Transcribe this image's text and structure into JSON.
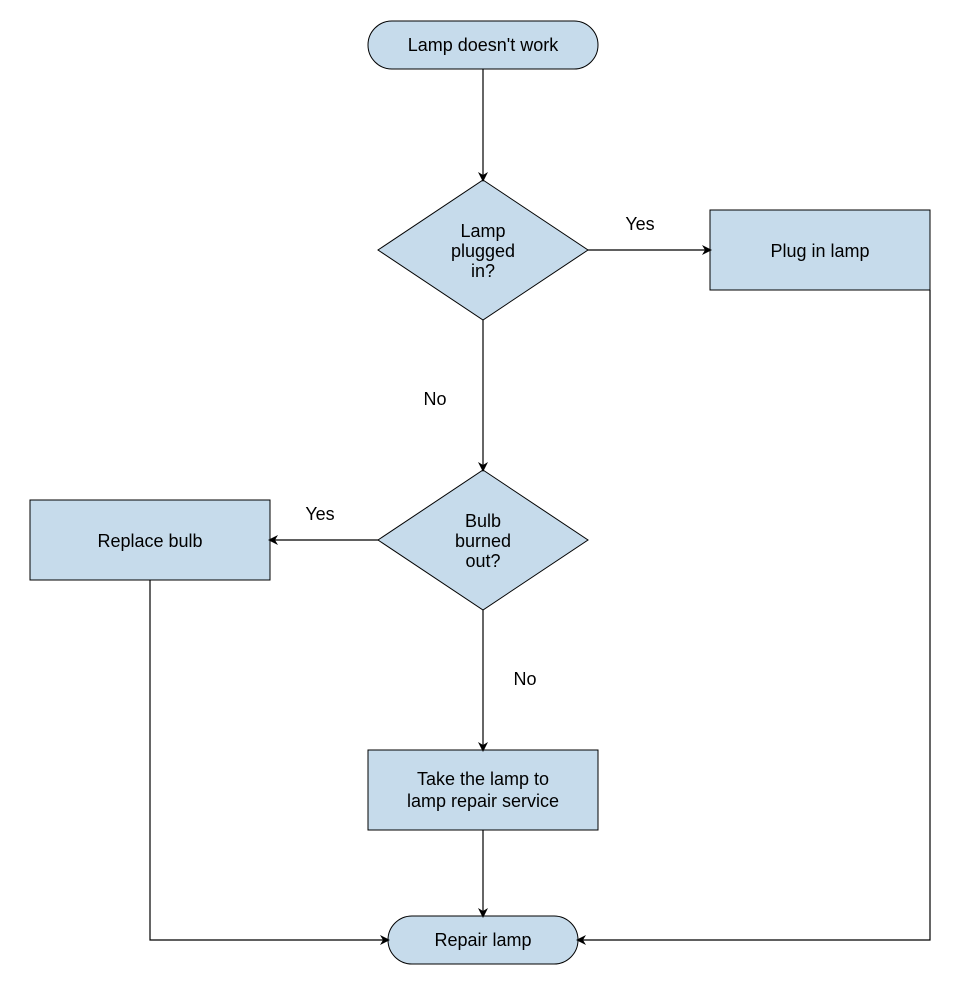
{
  "chart_data": {
    "type": "flowchart",
    "nodes": [
      {
        "id": "start",
        "shape": "terminator",
        "label": "Lamp doesn't work"
      },
      {
        "id": "plugged",
        "shape": "decision",
        "label": "Lamp plugged in?"
      },
      {
        "id": "plugin",
        "shape": "process",
        "label": "Plug in lamp"
      },
      {
        "id": "burned",
        "shape": "decision",
        "label": "Bulb burned out?"
      },
      {
        "id": "replace",
        "shape": "process",
        "label": "Replace bulb"
      },
      {
        "id": "service",
        "shape": "process",
        "label": "Take the lamp to lamp repair service"
      },
      {
        "id": "end",
        "shape": "terminator",
        "label": "Repair lamp"
      }
    ],
    "edges": [
      {
        "from": "start",
        "to": "plugged",
        "label": ""
      },
      {
        "from": "plugged",
        "to": "plugin",
        "label": "Yes"
      },
      {
        "from": "plugged",
        "to": "burned",
        "label": "No"
      },
      {
        "from": "burned",
        "to": "replace",
        "label": "Yes"
      },
      {
        "from": "burned",
        "to": "service",
        "label": "No"
      },
      {
        "from": "service",
        "to": "end",
        "label": ""
      },
      {
        "from": "replace",
        "to": "end",
        "label": ""
      },
      {
        "from": "plugin",
        "to": "end",
        "label": ""
      }
    ]
  },
  "nodes": {
    "start": {
      "label": "Lamp doesn't work"
    },
    "plugged": {
      "line1": "Lamp",
      "line2": "plugged",
      "line3": "in?"
    },
    "plugin": {
      "label": "Plug in lamp"
    },
    "burned": {
      "line1": "Bulb",
      "line2": "burned",
      "line3": "out?"
    },
    "replace": {
      "label": "Replace bulb"
    },
    "service": {
      "line1": "Take the lamp to",
      "line2": "lamp repair service"
    },
    "end": {
      "label": "Repair lamp"
    }
  },
  "edge_labels": {
    "plugged_yes": "Yes",
    "plugged_no": "No",
    "burned_yes": "Yes",
    "burned_no": "No"
  }
}
